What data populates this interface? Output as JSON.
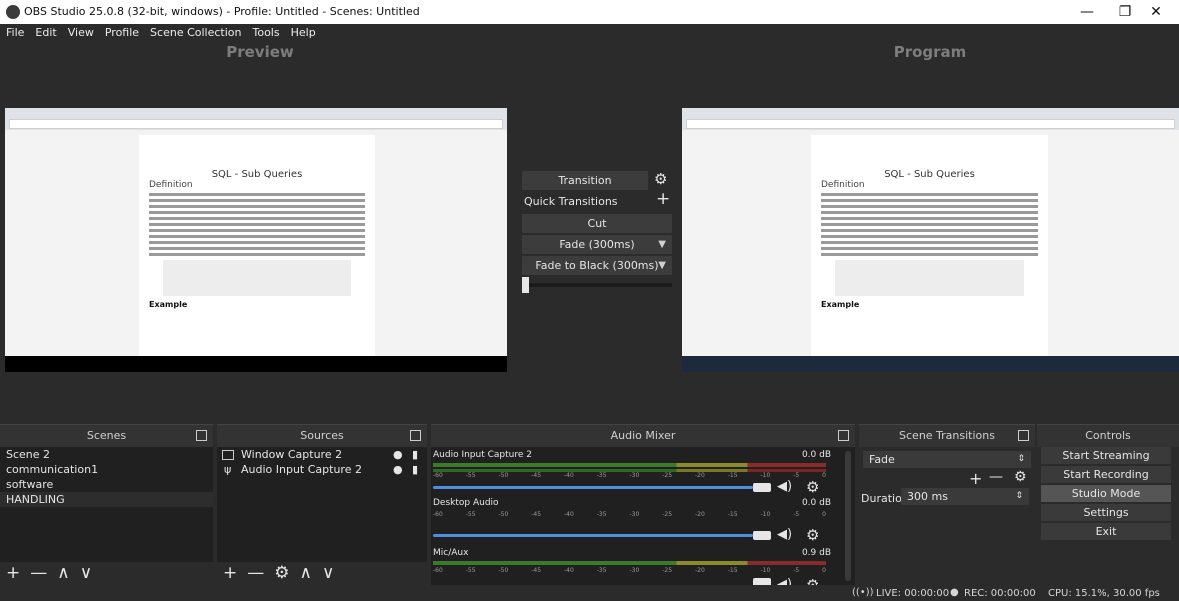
{
  "window": {
    "title": "OBS Studio 25.0.8 (32-bit, windows) - Profile: Untitled - Scenes: Untitled",
    "minimize": "—",
    "maximize": "❐",
    "close": "✕"
  },
  "menu": [
    "File",
    "Edit",
    "View",
    "Profile",
    "Scene Collection",
    "Tools",
    "Help"
  ],
  "preview": {
    "title": "Preview"
  },
  "program": {
    "title": "Program"
  },
  "document": {
    "title": "SQL - Sub Queries",
    "heading": "Definition",
    "example": "Example"
  },
  "transitions_center": {
    "transition_button": "Transition",
    "quick_transitions": "Quick Transitions",
    "items": [
      "Cut",
      "Fade (300ms)",
      "Fade to Black (300ms)"
    ]
  },
  "scenes": {
    "title": "Scenes",
    "items": [
      "Scene 2",
      "communication1",
      "software",
      "HANDLING"
    ],
    "selected": "HANDLING"
  },
  "sources": {
    "title": "Sources",
    "items": [
      "Window Capture 2",
      "Audio Input Capture 2"
    ]
  },
  "audio_mixer": {
    "title": "Audio Mixer",
    "ticks": [
      "-60",
      "-55",
      "-50",
      "-45",
      "-40",
      "-35",
      "-30",
      "-25",
      "-20",
      "-15",
      "-10",
      "-5",
      "0"
    ],
    "channels": [
      {
        "name": "Audio Input Capture 2",
        "db": "0.0 dB"
      },
      {
        "name": "Desktop Audio",
        "db": "0.0 dB"
      },
      {
        "name": "Mic/Aux",
        "db": "0.9 dB"
      }
    ]
  },
  "scene_transitions": {
    "title": "Scene Transitions",
    "selected": "Fade",
    "duration_label": "Duration",
    "duration_value": "300 ms"
  },
  "controls": {
    "title": "Controls",
    "start_streaming": "Start Streaming",
    "start_recording": "Start Recording",
    "studio_mode": "Studio Mode",
    "settings": "Settings",
    "exit": "Exit"
  },
  "status": {
    "live": "LIVE: 00:00:00",
    "rec": "REC: 00:00:00",
    "cpu": "CPU: 15.1%, 30.00 fps"
  },
  "icons": {
    "gear": "gear-icon",
    "plus": "plus-icon",
    "minus": "minus-icon",
    "up": "up-icon",
    "down": "down-icon",
    "eye": "eye-icon",
    "lock": "lock-icon",
    "speaker": "speaker-icon"
  },
  "colors": {
    "background": "#2b2b2b",
    "dock_body": "#202020",
    "slider": "#4a8fe0"
  }
}
